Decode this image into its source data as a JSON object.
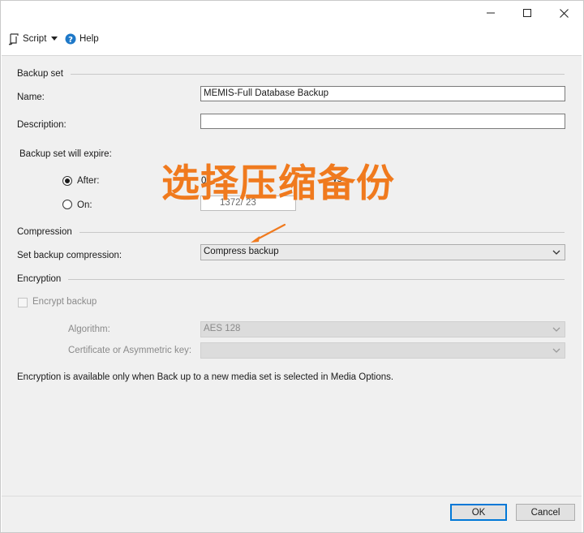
{
  "window": {
    "controls": {
      "minimize": "—",
      "maximize": "☐",
      "close": "✕"
    }
  },
  "toolbar": {
    "script_label": "Script",
    "help_label": "Help"
  },
  "backup_set": {
    "section_title": "Backup set",
    "name_label": "Name:",
    "name_value": "MEMIS-Full Database Backup",
    "description_label": "Description:",
    "description_value": "",
    "expire_label": "Backup set will expire:",
    "after_label": "After:",
    "after_value_partial": "0",
    "after_unit_partial": "ys",
    "on_label": "On:",
    "on_value_partial": "1372/  23",
    "selected_option": "After"
  },
  "compression": {
    "section_title": "Compression",
    "set_label": "Set backup compression:",
    "selected_value": "Compress backup"
  },
  "encryption": {
    "section_title": "Encryption",
    "encrypt_label": "Encrypt backup",
    "encrypt_checked": false,
    "algorithm_label": "Algorithm:",
    "algorithm_value": "AES 128",
    "certificate_label": "Certificate or Asymmetric key:",
    "certificate_value": "",
    "note": "Encryption is available only when Back up to a new media set is selected in Media Options."
  },
  "annotation": {
    "text": "选择压缩备份",
    "color": "#f07a1e"
  },
  "footer": {
    "ok_label": "OK",
    "cancel_label": "Cancel"
  },
  "colors": {
    "accent": "#0078d7",
    "annotation": "#f07a1e",
    "help_icon": "#1e78c8"
  }
}
